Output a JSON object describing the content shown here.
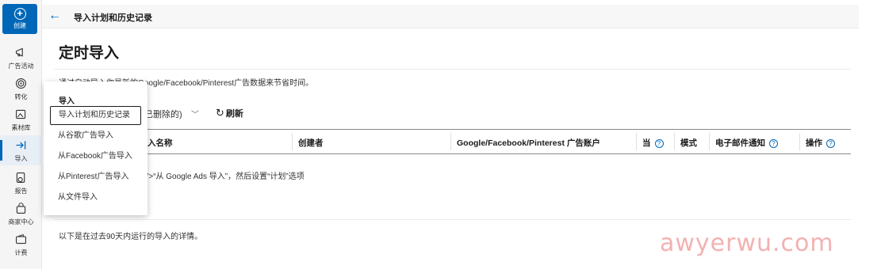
{
  "rail": {
    "create_label": "创建",
    "items": [
      {
        "label": "广告活动",
        "icon": "megaphone-icon"
      },
      {
        "label": "转化",
        "icon": "target-icon"
      },
      {
        "label": "素材库",
        "icon": "image-library-icon"
      },
      {
        "label": "导入",
        "icon": "import-arrow-icon"
      },
      {
        "label": "报告",
        "icon": "report-chart-icon"
      },
      {
        "label": "商家中心",
        "icon": "store-bag-icon"
      },
      {
        "label": "计费",
        "icon": "wallet-icon"
      }
    ]
  },
  "header": {
    "breadcrumb": "导入计划和历史记录"
  },
  "page": {
    "title": "定时导入",
    "description": "通过自动导入你最新的Google/Facebook/Pinterest广告数据来节省时间。",
    "filter_label": "已删除的)",
    "refresh_label": "刷新"
  },
  "table": {
    "columns": {
      "name": "入名称",
      "creator": "创建者",
      "account": "Google/Facebook/Pinterest 广告账户",
      "when": "当",
      "mode": "模式",
      "email": "电子邮件通知",
      "actions": "操作"
    },
    "empty_row_text": "入”>“从 Google Ads 导入”，然后设置“计划”选项"
  },
  "footer_text": "以下是在过去90天内运行的导入的详情。",
  "menu": {
    "heading": "导入",
    "items": [
      "导入计划和历史记录",
      "从谷歌广告导入",
      "从Facebook广告导入",
      "从Pinterest广告导入",
      "从文件导入"
    ],
    "selected_index": 0
  },
  "watermark": "awyerwu.com",
  "colors": {
    "accent": "#0067b8",
    "watermark": "#f2a9a9"
  }
}
